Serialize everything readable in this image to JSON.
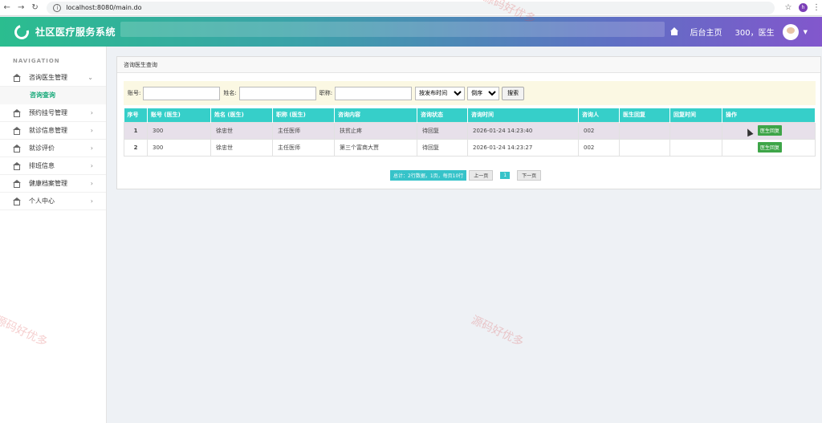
{
  "browser": {
    "url": "localhost:8080/main.do",
    "profile_initial": "h"
  },
  "header": {
    "title": "社区医疗服务系统",
    "home_label": "后台主页",
    "user_label": "300，医生"
  },
  "sidebar": {
    "nav_label": "NAVIGATION",
    "items": [
      {
        "label": "咨询医生管理",
        "expanded": true,
        "children": [
          {
            "label": "咨询查询"
          }
        ]
      },
      {
        "label": "预约挂号管理"
      },
      {
        "label": "就诊信息管理"
      },
      {
        "label": "就诊评价"
      },
      {
        "label": "排班信息"
      },
      {
        "label": "健康档案管理"
      },
      {
        "label": "个人中心"
      }
    ]
  },
  "panel": {
    "title": "咨询医生查询",
    "search": {
      "account_label": "账号:",
      "name_label": "姓名:",
      "title_label": "职称:",
      "sort_field": "按发布时间",
      "sort_order": "倒序",
      "search_button": "搜索"
    },
    "table": {
      "headers": [
        "序号",
        "账号 (医生)",
        "姓名 (医生)",
        "职称 (医生)",
        "咨询内容",
        "咨询状态",
        "咨询时间",
        "咨询人",
        "医生回复",
        "回复时间",
        "操作"
      ],
      "rows": [
        {
          "no": "1",
          "account": "300",
          "name": "徐忠世",
          "title": "主任医师",
          "content": "扶贫止疼",
          "status": "待回复",
          "time": "2026-01-24 14:23:40",
          "asker": "002",
          "reply": "",
          "reply_time": "",
          "action": "医生回复"
        },
        {
          "no": "2",
          "account": "300",
          "name": "徐忠世",
          "title": "主任医师",
          "content": "第三个富商大贾",
          "status": "待回复",
          "time": "2026-01-24 14:23:27",
          "asker": "002",
          "reply": "",
          "reply_time": "",
          "action": "医生回复"
        }
      ]
    },
    "pager": {
      "info": "总计：2行数据，1页，每页10行",
      "prev": "上一页",
      "current": "1",
      "next": "下一页"
    }
  },
  "watermark": "源码好优多",
  "colors": {
    "header_start": "#2bbd8f",
    "header_end": "#8257cc",
    "table_header": "#36cfc9",
    "reply_button": "#3ea548",
    "active_menu": "#1aaa7b"
  }
}
